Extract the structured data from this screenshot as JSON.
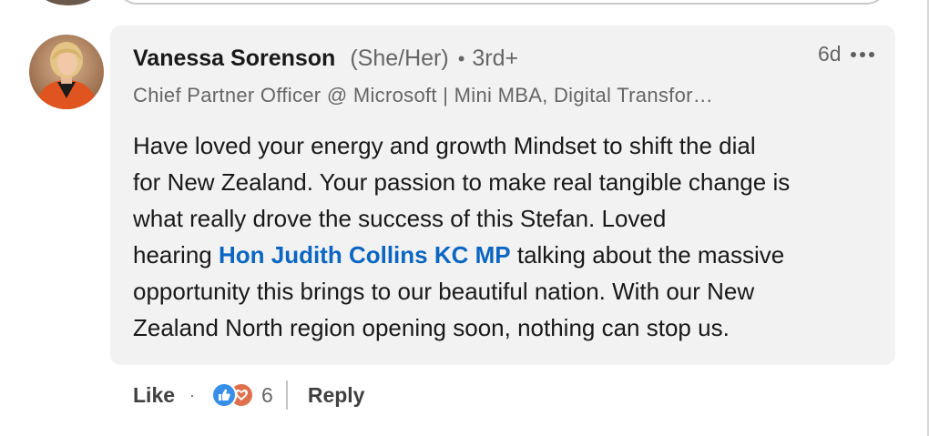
{
  "comment": {
    "author_name": "Vanessa Sorenson",
    "pronouns": "(She/Her)",
    "separator": "•",
    "degree": "3rd+",
    "timestamp": "6d",
    "headline": "Chief Partner Officer @ Microsoft | Mini MBA, Digital Transfor…",
    "body": {
      "line1": "Have loved your energy and growth Mindset to shift the dial",
      "line2": "for New Zealand. Your passion to make real tangible change is",
      "line3": "what really drove the success of this Stefan. Loved",
      "line4_before": "hearing ",
      "mention": "Hon Judith Collins KC MP",
      "line4_after": " talking about the massive",
      "line5": "opportunity this brings to our beautiful nation. With our New",
      "line6": "Zealand North region opening soon, nothing can stop us."
    }
  },
  "actions": {
    "like_label": "Like",
    "dot": "·",
    "reaction_count": "6",
    "reply_label": "Reply"
  },
  "icons": {
    "more": "more-horizontal-icon",
    "like_reaction": "like-reaction-icon",
    "love_reaction": "love-reaction-icon"
  },
  "colors": {
    "bubble_bg": "#f2f2f2",
    "mention": "#0a66c2",
    "like": "#378fe9",
    "love": "#df704d",
    "secondary_text": "#666666"
  }
}
